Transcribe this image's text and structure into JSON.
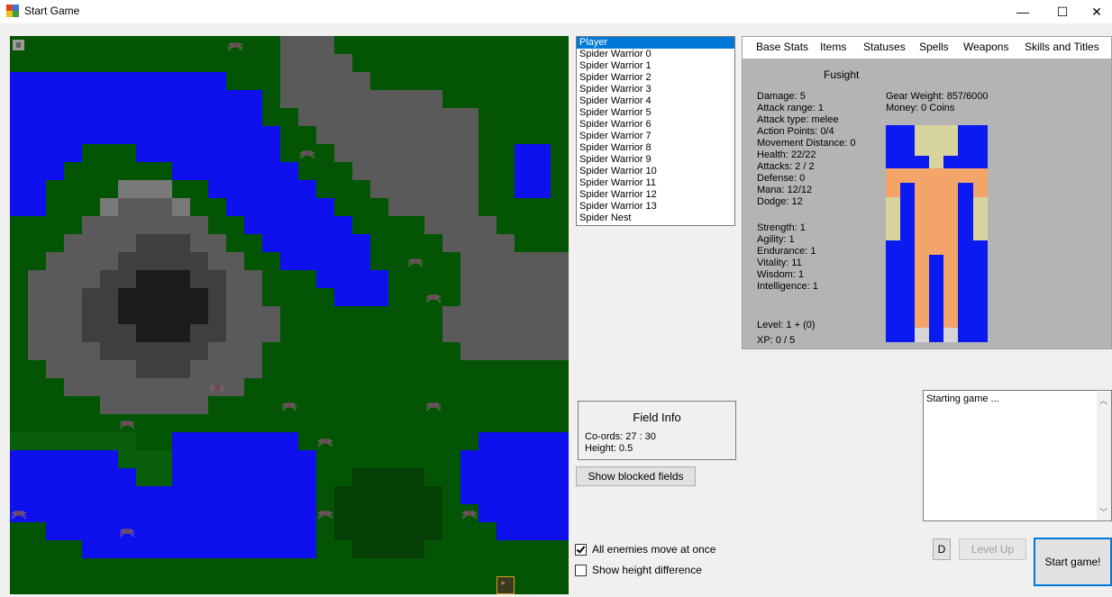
{
  "window": {
    "title": "Start Game",
    "controls": {
      "minimize": "—",
      "maximize": "☐",
      "close": "✕"
    }
  },
  "map": {
    "cols": 31,
    "rows": 31,
    "legend": {
      "W": "#0e10ee",
      "G": "#035503",
      "D": "#064006",
      "L": "#095f09",
      "M": "#5a5a5a",
      "K": "#3f3f3f",
      "B": "#1c1c1c",
      "P": "#787878"
    },
    "tiles": [
      "GGGGGGGGGGGGGGGMMMGGGGGGGGGGGGG",
      "GGGGGGGGGGGGGGGMMMMGGGGGGGGGGGG",
      "WWWWWWWWWWWWGGGMMMMMGGGGGGGGGGG",
      "WWWWWWWWWWWWWWGMMMMMMMMMGGGGGGG",
      "WWWWWWWWWWWWWWGGMMMMMMMMMMGGGGG",
      "WWWWWWWWWWWWWWWGGMMMMMMMMMGGGGG",
      "WWWWGGGWWWWWWWWGGGMMMMMMMMGGWWG",
      "WWWGGGGGGWWWWWWWGGGMMMMMMMGGWWG",
      "WWGGGGPPPGGWWWWWWGGGMMMMMMGGWWG",
      "WWGGGPMMMPGGWWWWWWGGGMMMMMGGGGG",
      "GGGGMMMMMMMGGWWWWWWGGGGMMMMGGGG",
      "GGGMMMMKKKMMGGWWWWWWGGGGMMMMGGG",
      "GGMMMMKKKKKMMGGWWWWWGGGGGMMMMMM",
      "GMMMMKKBBBKKMMGGGWWWWGGGGMMMMMM",
      "GMMMKKBBBBBKMMGGGGWWWGGGGMMMMMM",
      "GMMMKKBBBBBKMMMGGGGGGGGGMMMMMMM",
      "GMMMKKKBBBKKMMMGGGGGGGGGMMMMMMM",
      "GMMMMKKKKKKMMMGGGGGGGGGGGMMMMMM",
      "GGMMMMMKKKMMMMGGGGGGGGGGGGGGGGG",
      "GGGMMMMMMMMMMGGGGGGGGGGGGGGGGGG",
      "GGGGGMMMMMMGGGGGGGGGGGGGGGGGGGG",
      "GGGGGGGGGGGGGGGGGGGGGGGGGGGGGGG",
      "LLLLLLLGGWWWWWWWGGGGGGGGGGWWWWW",
      "WWWWWWLLLWWWWWWWWGGGGGGGGWWWWWW",
      "WWWWWWWLLWWWWWWWWGGDDDDGGWWWWWW",
      "WWWWWWWWWWWWWWWWWGDDDDDDGWWWWWW",
      "WWWWWWWWWWWWWWWWWGDDDDDDGGWWWWW",
      "GGWWWWWWWWWWWWWWWGDDDDDDGGGWWWW",
      "GGGGWWWWWWWWWWWWWGGDDDDGGGGGGGG",
      "GGGGGGGGGGGGGGGGGGGGGGGGGGGGGGG",
      "GGGGGGGGGGGGGGGGGGGGGGGGGGGGGGG"
    ],
    "spiders": [
      [
        12,
        0
      ],
      [
        16,
        6
      ],
      [
        22,
        12
      ],
      [
        23,
        14
      ],
      [
        11,
        19
      ],
      [
        15,
        20
      ],
      [
        23,
        20
      ],
      [
        6,
        21
      ],
      [
        17,
        22
      ],
      [
        0,
        26
      ],
      [
        6,
        27
      ],
      [
        17,
        26
      ],
      [
        25,
        26
      ]
    ],
    "player": [
      0,
      0
    ],
    "nest": [
      27,
      30
    ]
  },
  "unit_list": {
    "items": [
      "Player",
      "Spider Warrior 0",
      "Spider Warrior 1",
      "Spider Warrior 2",
      "Spider Warrior 3",
      "Spider Warrior 4",
      "Spider Warrior 5",
      "Spider Warrior 6",
      "Spider Warrior 7",
      "Spider Warrior 8",
      "Spider Warrior 9",
      "Spider Warrior 10",
      "Spider Warrior 11",
      "Spider Warrior 12",
      "Spider Warrior 13",
      "Spider Nest"
    ],
    "selected_index": 0
  },
  "tabs": [
    "Base Stats",
    "Items",
    "Statuses",
    "Spells",
    "Weapons",
    "Skills and Titles"
  ],
  "stats": {
    "name": "Fusight",
    "combat": [
      "Damage: 5",
      "Attack range: 1",
      "Attack type: melee",
      "Action Points: 0/4",
      "Movement Distance: 0",
      "Health: 22/22",
      "Attacks: 2 / 2",
      "Defense: 0",
      "Mana: 12/12",
      "Dodge: 12"
    ],
    "attributes": [
      "Strength: 1",
      "Agility: 1",
      "Endurance: 1",
      "Vitality: 11",
      "Wisdom: 1",
      "Intelligence: 1"
    ],
    "level": "Level: 1 + (0)",
    "xp": "XP: 0 / 5",
    "gear_weight": "Gear Weight: 857/6000",
    "money": "Money: 0 Coins"
  },
  "field_info": {
    "title": "Field Info",
    "coords": "Co-ords: 27 : 30",
    "height": "Height: 0.5"
  },
  "buttons": {
    "show_blocked": "Show blocked fields",
    "d": "D",
    "level_up": "Level Up",
    "start_game": "Start game!"
  },
  "log": {
    "text": "Starting game ..."
  },
  "checkboxes": {
    "all_enemies": {
      "label": "All enemies move at once",
      "checked": true
    },
    "height_diff": {
      "label": "Show height difference",
      "checked": false
    }
  },
  "colors": {
    "selection": "#0078d7",
    "body_blue": "#0a1af0",
    "body_skin": "#f2a469",
    "body_khaki": "#d8d49e",
    "stats_bg": "#b4b4b4"
  }
}
